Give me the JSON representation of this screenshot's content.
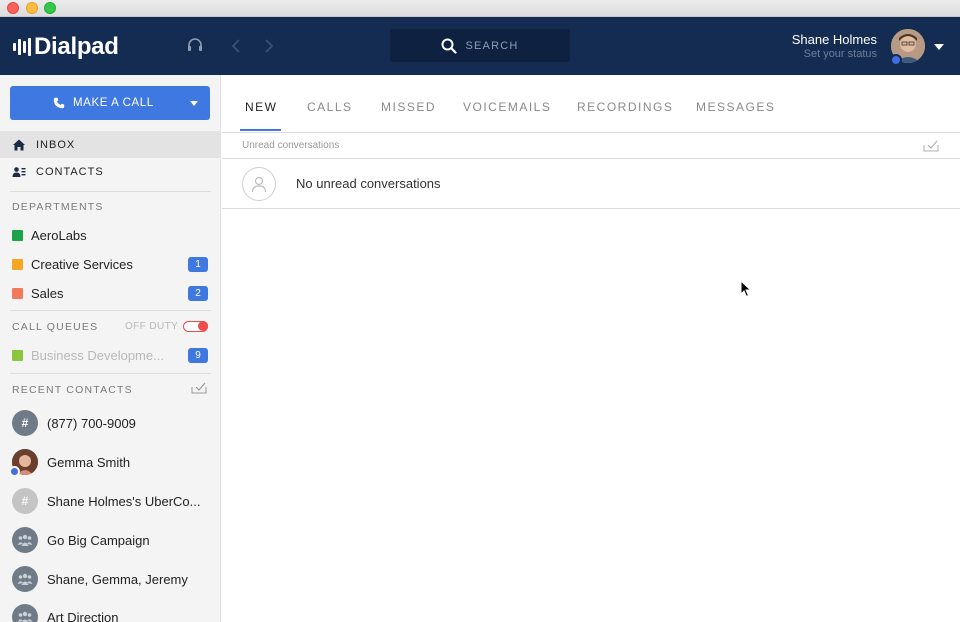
{
  "window": {
    "controls": [
      "close",
      "minimize",
      "zoom"
    ]
  },
  "topbar": {
    "logo_text": "Dialpad",
    "headset_icon": "headset-icon",
    "back_icon": "chevron-left-icon",
    "forward_icon": "chevron-right-icon",
    "search_label": "SEARCH",
    "user": {
      "name": "Shane Holmes",
      "status": "Set your status"
    }
  },
  "sidebar": {
    "make_call_label": "MAKE A CALL",
    "nav": [
      {
        "label": "INBOX",
        "icon": "home-icon",
        "active": true
      },
      {
        "label": "CONTACTS",
        "icon": "contacts-icon",
        "active": false
      }
    ],
    "departments_label": "DEPARTMENTS",
    "departments": [
      {
        "name": "AeroLabs",
        "color": "#1aa34a",
        "badge": ""
      },
      {
        "name": "Creative Services",
        "color": "#f5a623",
        "badge": "1"
      },
      {
        "name": "Sales",
        "color": "#f07a5a",
        "badge": "2"
      }
    ],
    "call_queues_label": "CALL QUEUES",
    "off_duty_label": "OFF DUTY",
    "queues": [
      {
        "name": "Business Developme...",
        "color": "#8cc63f",
        "badge": "9"
      }
    ],
    "recent_contacts_label": "RECENT CONTACTS",
    "recent_contacts": [
      {
        "name": "(877) 700-9009",
        "avatar": "#",
        "avatar_color": "#707b88"
      },
      {
        "name": "Gemma Smith",
        "avatar": "",
        "avatar_color": "#8a5a48"
      },
      {
        "name": "Shane Holmes's UberCo...",
        "avatar": "#",
        "avatar_color": "#c4c4c4"
      },
      {
        "name": "Go Big Campaign",
        "avatar": "",
        "avatar_color": "#707b88"
      },
      {
        "name": "Shane, Gemma, Jeremy",
        "avatar": "",
        "avatar_color": "#707b88"
      },
      {
        "name": "Art Direction",
        "avatar": "",
        "avatar_color": "#707b88"
      }
    ]
  },
  "main": {
    "tabs": [
      {
        "label": "NEW",
        "active": true
      },
      {
        "label": "CALLS",
        "active": false
      },
      {
        "label": "MISSED",
        "active": false
      },
      {
        "label": "VOICEMAILS",
        "active": false
      },
      {
        "label": "RECORDINGS",
        "active": false
      },
      {
        "label": "MESSAGES",
        "active": false
      }
    ],
    "section_label": "Unread conversations",
    "empty_message": "No unread conversations"
  },
  "colors": {
    "topbar": "#142c52",
    "accent": "#3f78e0",
    "sidebar": "#f4f4f4"
  }
}
